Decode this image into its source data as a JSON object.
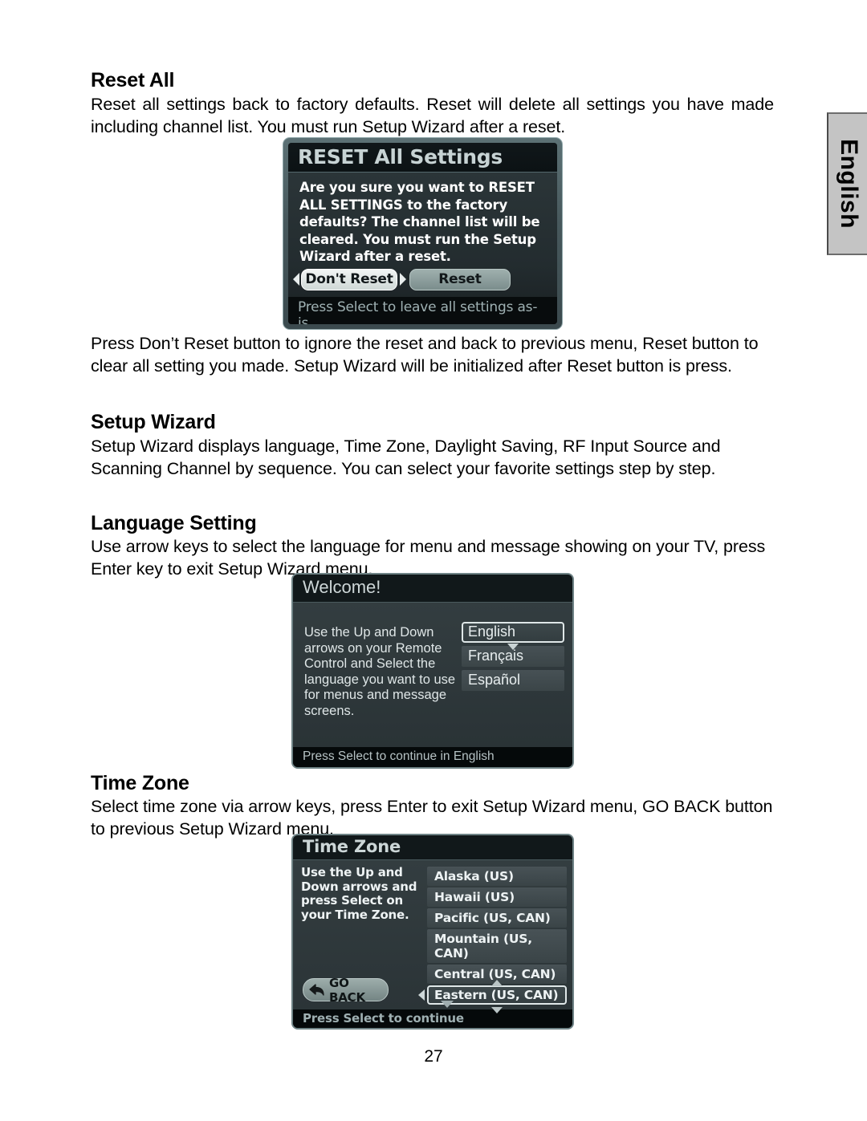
{
  "page": {
    "number": "27",
    "side_tab_label": "English"
  },
  "sections": {
    "reset_all": {
      "heading": "Reset All",
      "intro": "Reset all settings back to factory defaults. Reset will delete all settings you have made including channel list. You must run Setup Wizard after a reset.",
      "outro": "Press Don’t Reset button to ignore the reset and back to previous menu, Reset button to clear all setting you made. Setup Wizard will be initialized after Reset button is press."
    },
    "setup_wizard": {
      "heading": "Setup Wizard",
      "text": "Setup Wizard displays language, Time Zone, Daylight Saving, RF Input Source and Scanning Channel by sequence. You can select your favorite settings step by step."
    },
    "language_setting": {
      "heading": "Language Setting",
      "text": "Use arrow keys to select the language for menu and message showing on your TV, press Enter key to exit Setup Wizard menu."
    },
    "time_zone": {
      "heading": "Time Zone",
      "text": "Select time zone via arrow keys, press Enter to exit Setup Wizard menu, GO BACK button to previous Setup Wizard menu."
    }
  },
  "figures": {
    "reset_dialog": {
      "title": "RESET All Settings",
      "message": "Are you sure you want to RESET ALL SETTINGS to the factory defaults? The channel list will be cleared. You must run the Setup Wizard after a reset.",
      "button_dont_reset": "Don't Reset",
      "button_reset": "Reset",
      "footer": "Press Select to leave all settings as-is"
    },
    "welcome_dialog": {
      "title": "Welcome!",
      "instruction": "Use the Up and Down arrows on your Remote Control and Select the language you want to use for menus and message screens.",
      "languages": [
        {
          "label": "English",
          "selected": true
        },
        {
          "label": "Français",
          "selected": false
        },
        {
          "label": "Español",
          "selected": false
        }
      ],
      "footer": "Press Select to continue in English"
    },
    "timezone_dialog": {
      "title": "Time Zone",
      "instruction": "Use the Up and Down arrows and press Select on your Time Zone.",
      "zones": [
        {
          "label": "Alaska (US)",
          "selected": false
        },
        {
          "label": "Hawaii (US)",
          "selected": false
        },
        {
          "label": "Pacific (US, CAN)",
          "selected": false
        },
        {
          "label": "Mountain (US, CAN)",
          "selected": false
        },
        {
          "label": "Central (US, CAN)",
          "selected": false
        },
        {
          "label": "Eastern (US, CAN)",
          "selected": true
        }
      ],
      "go_back_label": "GO BACK",
      "footer": "Press Select to continue"
    }
  }
}
